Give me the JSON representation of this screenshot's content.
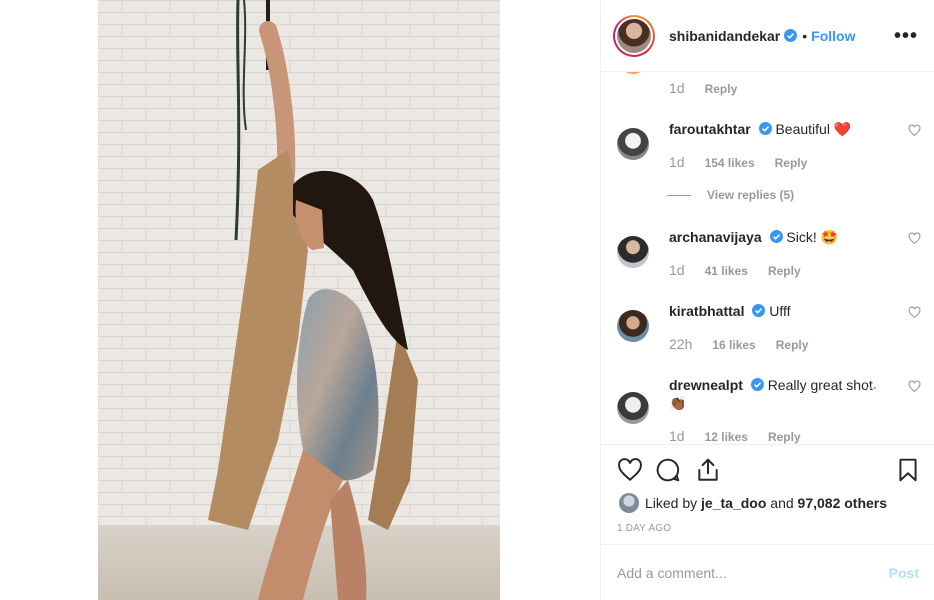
{
  "post": {
    "owner": "shibanidandekar",
    "separator": "•",
    "follow_label": "Follow",
    "more_label": "•••"
  },
  "partial_comment": {
    "time": "1d",
    "reply_label": "Reply"
  },
  "comments": [
    {
      "user": "faroutakhtar",
      "text": "Beautiful",
      "emoji": "❤️",
      "time": "1d",
      "likes": "154 likes",
      "reply_label": "Reply"
    },
    {
      "user": "archanavijaya",
      "text": "Sick!",
      "emoji": "🤩",
      "time": "1d",
      "likes": "41 likes",
      "reply_label": "Reply"
    },
    {
      "user": "kiratbhattal",
      "text": "Ufff",
      "emoji": "",
      "time": "22h",
      "likes": "16 likes",
      "reply_label": "Reply"
    },
    {
      "user": "drewnealpt",
      "text": "Really great shot",
      "emoji": "👏🏾",
      "time": "1d",
      "likes": "12 likes",
      "reply_label": "Reply"
    }
  ],
  "view_replies": "View replies (5)",
  "truncation_more": "...",
  "likes_line": {
    "prefix": "Liked by",
    "user": "je_ta_doo",
    "and": "and",
    "others": "97,082 others"
  },
  "timestamp": "1 DAY AGO",
  "add_comment": {
    "placeholder": "Add a comment...",
    "post_label": "Post"
  },
  "colors": {
    "accent": "#3897f0",
    "verified": "#3897f0",
    "muted": "#999999",
    "post_disabled": "#b2dffc"
  }
}
